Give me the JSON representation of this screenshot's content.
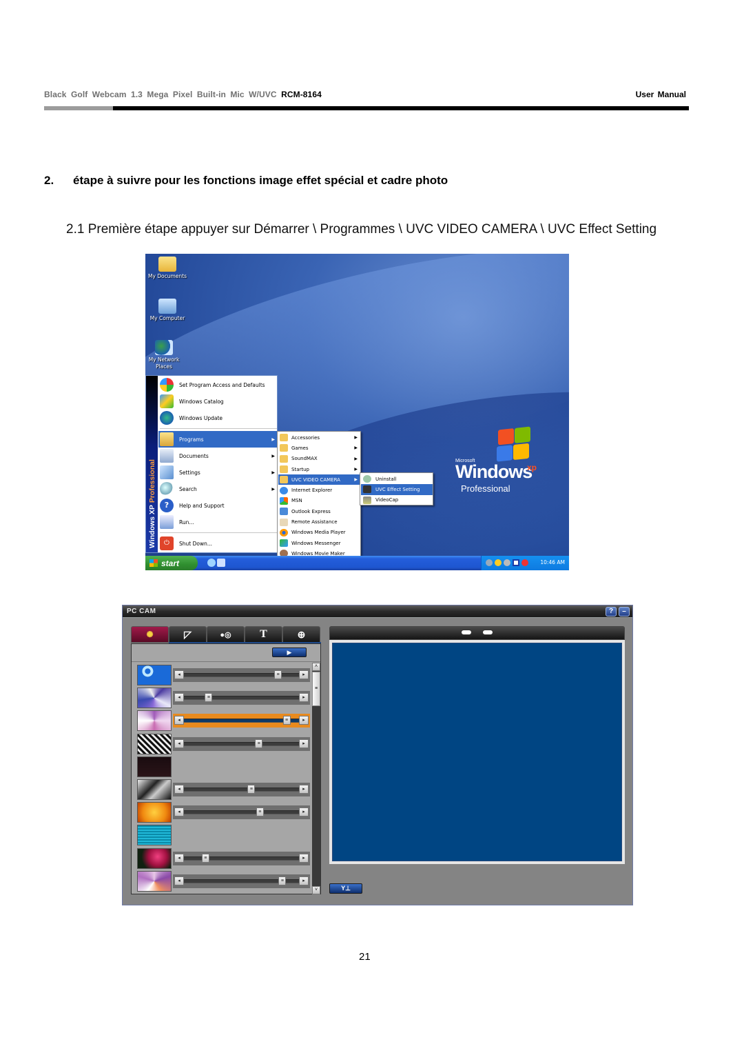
{
  "header": {
    "product": "Black  Golf  Webcam 1.3 Mega Pixel Built-in Mic W/UVC",
    "model": "RCM-8164",
    "doc_type": "User  Manual"
  },
  "section": {
    "number": "2.",
    "title": "étape à suivre pour les fonctions image effet spécial et cadre photo"
  },
  "step": {
    "text": "2.1 Première étape appuyer sur Démarrer \\ Programmes \\ UVC VIDEO CAMERA \\ UVC Effect Setting"
  },
  "desktop": {
    "icons": [
      {
        "label": "My Documents",
        "icon": "folder-icon"
      },
      {
        "label": "My Computer",
        "icon": "computer-icon"
      },
      {
        "label": "My Network Places",
        "icon": "network-icon"
      }
    ],
    "start_menu": {
      "strip_text_a": "Windows XP",
      "strip_text_b": "Professional",
      "top_items": [
        {
          "label": "Set Program Access and Defaults",
          "icon": "program-access-icon"
        },
        {
          "label": "Windows Catalog",
          "icon": "catalog-icon"
        },
        {
          "label": "Windows Update",
          "icon": "windows-update-icon"
        }
      ],
      "items": [
        {
          "label": "Programs",
          "icon": "programs-icon",
          "submenu": true,
          "selected": true
        },
        {
          "label": "Documents",
          "icon": "documents-icon",
          "submenu": true
        },
        {
          "label": "Settings",
          "icon": "settings-icon",
          "submenu": true
        },
        {
          "label": "Search",
          "icon": "search-icon",
          "submenu": true
        },
        {
          "label": "Help and Support",
          "icon": "help-icon",
          "submenu": false
        },
        {
          "label": "Run...",
          "icon": "run-icon",
          "submenu": false
        }
      ],
      "shutdown": {
        "label": "Shut Down...",
        "icon": "shutdown-icon"
      }
    },
    "programs_menu": [
      {
        "label": "Accessories",
        "submenu": true
      },
      {
        "label": "Games",
        "submenu": true
      },
      {
        "label": "SoundMAX",
        "submenu": true
      },
      {
        "label": "Startup",
        "submenu": true
      },
      {
        "label": "UVC VIDEO CAMERA",
        "submenu": true,
        "selected": true
      },
      {
        "label": "Internet Explorer",
        "submenu": false
      },
      {
        "label": "MSN",
        "submenu": false
      },
      {
        "label": "Outlook Express",
        "submenu": false
      },
      {
        "label": "Remote Assistance",
        "submenu": false
      },
      {
        "label": "Windows Media Player",
        "submenu": false
      },
      {
        "label": "Windows Messenger",
        "submenu": false
      },
      {
        "label": "Windows Movie Maker",
        "submenu": false
      }
    ],
    "uvc_submenu": [
      {
        "label": "Uninstall"
      },
      {
        "label": "UVC Effect Setting",
        "selected": true
      },
      {
        "label": "VideoCap"
      }
    ],
    "logo": {
      "microsoft": "Microsoft",
      "windows": "Windows",
      "xp": "xp",
      "edition": "Professional"
    },
    "taskbar": {
      "start_label": "start",
      "clock": "10:46 AM"
    }
  },
  "pccam": {
    "title": "PC CAM",
    "help_label": "?",
    "minimize_label": "–",
    "tabs": [
      {
        "name": "effects",
        "glyph": "✺",
        "active": true
      },
      {
        "name": "frames",
        "glyph": "◸"
      },
      {
        "name": "toggle",
        "glyph": "●◎"
      },
      {
        "name": "text",
        "glyph": "T"
      },
      {
        "name": "zoom",
        "glyph": "⊕"
      }
    ],
    "play_label": "▶",
    "settings_label": "Y⊥",
    "effects": [
      {
        "name": "effect-1",
        "has_slider": true,
        "value": 0.84
      },
      {
        "name": "effect-2",
        "has_slider": true,
        "value": 0.19
      },
      {
        "name": "effect-3",
        "has_slider": true,
        "value": 0.92,
        "active": true
      },
      {
        "name": "effect-4",
        "has_slider": true,
        "value": 0.66
      },
      {
        "name": "effect-5",
        "has_slider": false
      },
      {
        "name": "effect-6",
        "has_slider": true,
        "value": 0.59
      },
      {
        "name": "effect-7",
        "has_slider": true,
        "value": 0.67
      },
      {
        "name": "effect-8",
        "has_slider": false
      },
      {
        "name": "effect-9",
        "has_slider": true,
        "value": 0.16
      },
      {
        "name": "effect-10",
        "has_slider": true,
        "value": 0.88
      }
    ],
    "colors": {
      "preview": "#004583",
      "active_slider": "#e88a1e",
      "active_tab": "#a01a4a"
    }
  },
  "page_number": "21"
}
